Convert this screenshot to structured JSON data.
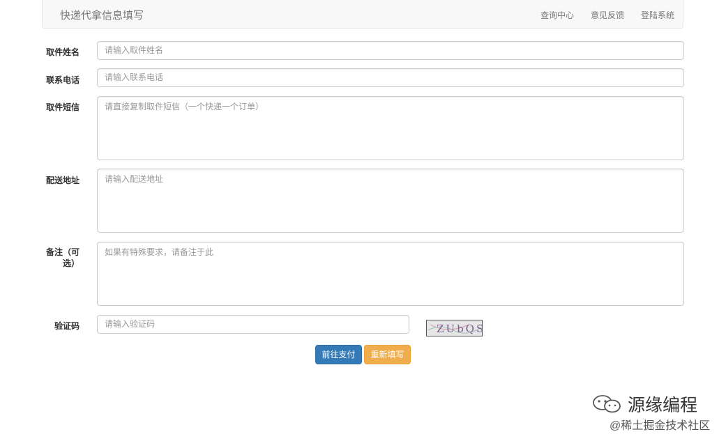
{
  "navbar": {
    "brand": "快递代拿信息填写",
    "links": [
      "查询中心",
      "意见反馈",
      "登陆系统"
    ]
  },
  "form": {
    "name": {
      "label": "取件姓名",
      "placeholder": "请输入取件姓名"
    },
    "phone": {
      "label": "联系电话",
      "placeholder": "请输入联系电话"
    },
    "sms": {
      "label": "取件短信",
      "placeholder": "请直接复制取件短信（一个快递一个订单）"
    },
    "address": {
      "label": "配送地址",
      "placeholder": "请输入配送地址"
    },
    "note": {
      "label_line1": "备注（可",
      "label_line2": "选）",
      "placeholder": "如果有特殊要求，请备注于此"
    },
    "captcha": {
      "label": "验证码",
      "placeholder": "请输入验证码",
      "image_text": "ZUbQS"
    }
  },
  "buttons": {
    "pay": "前往支付",
    "reset": "重新填写"
  },
  "watermark": {
    "line1": "源缘编程",
    "line2": "@稀土掘金技术社区"
  },
  "colors": {
    "primary": "#337ab7",
    "warning": "#f0ad4e"
  }
}
